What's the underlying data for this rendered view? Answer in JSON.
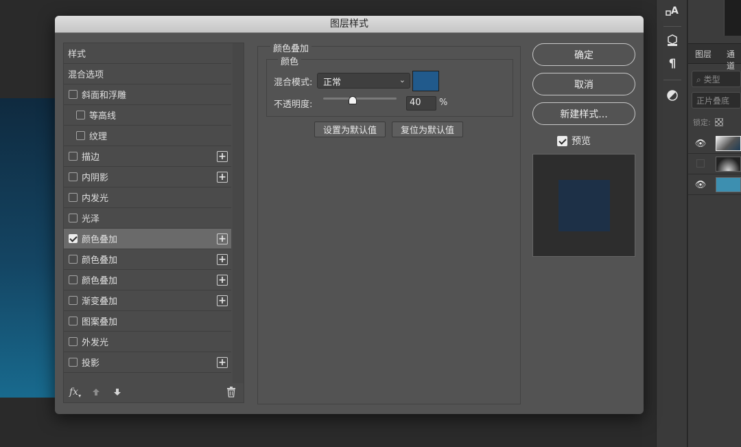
{
  "dialog": {
    "title": "图层样式"
  },
  "style_list": {
    "items": [
      {
        "label": "样式",
        "kind": "header",
        "checked": false,
        "plus": false
      },
      {
        "label": "混合选项",
        "kind": "header",
        "checked": false,
        "plus": false
      },
      {
        "label": "斜面和浮雕",
        "kind": "item",
        "checked": false,
        "plus": false
      },
      {
        "label": "等高线",
        "kind": "sub",
        "checked": false,
        "plus": false
      },
      {
        "label": "纹理",
        "kind": "sub",
        "checked": false,
        "plus": false
      },
      {
        "label": "描边",
        "kind": "item",
        "checked": false,
        "plus": true
      },
      {
        "label": "内阴影",
        "kind": "item",
        "checked": false,
        "plus": true
      },
      {
        "label": "内发光",
        "kind": "item",
        "checked": false,
        "plus": false
      },
      {
        "label": "光泽",
        "kind": "item",
        "checked": false,
        "plus": false
      },
      {
        "label": "颜色叠加",
        "kind": "item",
        "checked": true,
        "plus": true,
        "selected": true
      },
      {
        "label": "颜色叠加",
        "kind": "item",
        "checked": false,
        "plus": true
      },
      {
        "label": "颜色叠加",
        "kind": "item",
        "checked": false,
        "plus": true
      },
      {
        "label": "渐变叠加",
        "kind": "item",
        "checked": false,
        "plus": true
      },
      {
        "label": "图案叠加",
        "kind": "item",
        "checked": false,
        "plus": false
      },
      {
        "label": "外发光",
        "kind": "item",
        "checked": false,
        "plus": false
      },
      {
        "label": "投影",
        "kind": "item",
        "checked": false,
        "plus": true
      }
    ],
    "footer": {
      "fx_label": "fx",
      "icons": [
        "fx-icon",
        "move-up-icon",
        "move-down-icon",
        "trash-icon"
      ]
    }
  },
  "panel": {
    "legend": "颜色叠加",
    "color_group_legend": "颜色",
    "blend_mode_label": "混合模式:",
    "blend_mode_value": "正常",
    "swatch_color": "#215a8c",
    "opacity_label": "不透明度:",
    "opacity_value": "40",
    "opacity_percent": 40,
    "opacity_unit": "%",
    "set_default_label": "设置为默认值",
    "reset_default_label": "复位为默认值"
  },
  "actions": {
    "ok_label": "确定",
    "cancel_label": "取消",
    "new_style_label": "新建样式...",
    "preview_label": "预览",
    "preview_checked": true,
    "preview_color": "#1d3047"
  },
  "right_panel": {
    "tabs": [
      "图层",
      "通道"
    ],
    "search_placeholder": "类型",
    "blend_mode": "正片叠底",
    "lock_label": "锁定:",
    "layers": [
      {
        "visible": true,
        "thumb": "gradient-light"
      },
      {
        "visible": false,
        "thumb": "gradient-dark"
      },
      {
        "visible": true,
        "thumb": "#3d8fb0"
      }
    ]
  },
  "colors": {
    "accent": "#215a8c",
    "canvas_gradient": "#144563"
  }
}
